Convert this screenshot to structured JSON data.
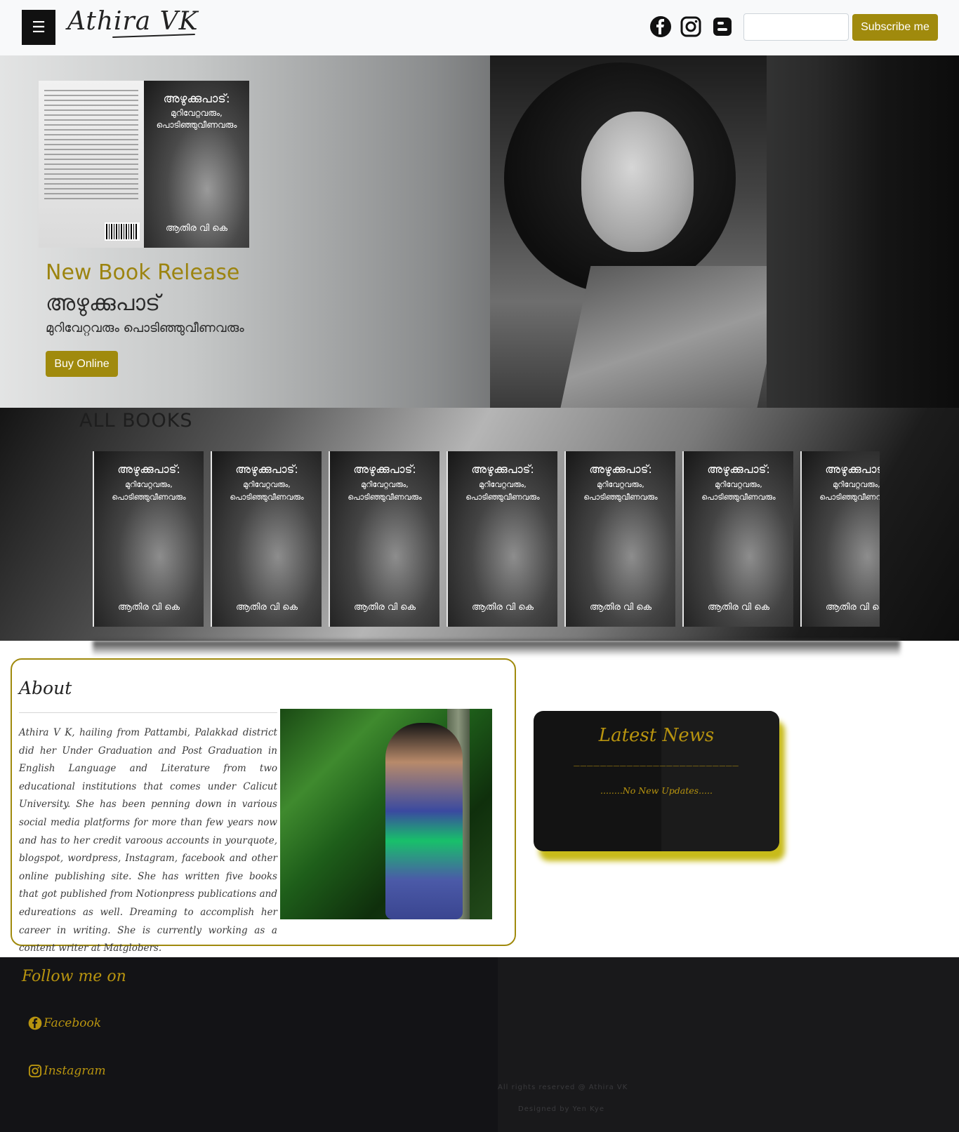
{
  "nav": {
    "menu_glyph": "☰",
    "brand": "Athira VK",
    "social_icons": [
      "facebook-icon",
      "instagram-icon",
      "blogger-icon"
    ],
    "subscribe_placeholder": "",
    "subscribe_label": "Subscribe me"
  },
  "hero": {
    "title": "New Book Release",
    "subtitle_line1": "അഴുക്കുപാട്",
    "subtitle_line2": "മുറിവേറ്റവരും പൊടിഞ്ഞുവീണവരും",
    "buy_label": "Buy Online",
    "book_cover": {
      "title": "അഴുക്കുപാട്:",
      "subtitle_1": "മുറിവേറ്റവരും,",
      "subtitle_2": "പൊടിഞ്ഞുവീണവരും",
      "author": "ആതിര വി കെ"
    }
  },
  "books": {
    "heading": "ALL BOOKS",
    "items": [
      {
        "title": "അഴുക്കുപാട്:",
        "subtitle_1": "മുറിവേറ്റവരും,",
        "subtitle_2": "പൊടിഞ്ഞുവീണവരും",
        "author": "ആതിര വി കെ"
      },
      {
        "title": "അഴുക്കുപാട്:",
        "subtitle_1": "മുറിവേറ്റവരും,",
        "subtitle_2": "പൊടിഞ്ഞുവീണവരും",
        "author": "ആതിര വി കെ"
      },
      {
        "title": "അഴുക്കുപാട്:",
        "subtitle_1": "മുറിവേറ്റവരും,",
        "subtitle_2": "പൊടിഞ്ഞുവീണവരും",
        "author": "ആതിര വി കെ"
      },
      {
        "title": "അഴുക്കുപാട്:",
        "subtitle_1": "മുറിവേറ്റവരും,",
        "subtitle_2": "പൊടിഞ്ഞുവീണവരും",
        "author": "ആതിര വി കെ"
      },
      {
        "title": "അഴുക്കുപാട്:",
        "subtitle_1": "മുറിവേറ്റവരും,",
        "subtitle_2": "പൊടിഞ്ഞുവീണവരും",
        "author": "ആതിര വി കെ"
      },
      {
        "title": "അഴുക്കുപാട്:",
        "subtitle_1": "മുറിവേറ്റവരും,",
        "subtitle_2": "പൊടിഞ്ഞുവീണവരും",
        "author": "ആതിര വി കെ"
      },
      {
        "title": "അഴുക്കുപാട്:",
        "subtitle_1": "മുറിവേറ്റവരും,",
        "subtitle_2": "പൊടിഞ്ഞുവീണവരും",
        "author": "ആതിര വി കെ"
      }
    ]
  },
  "about": {
    "title": "About",
    "text": "Athira V K, hailing from Pattambi, Palakkad district did her Under Graduation and Post Graduation in English Language and Literature from two educational institutions that comes under Calicut University. She has been penning down in various social media platforms for more than few years now and has to her credit varoous accounts in yourquote, blogspot, wordpress, Instagram, facebook and other online publishing site. She has written five books that got published from Notionpress publications and edureations as well. Dreaming to accomplish her career in writing. She is currently working as a content writer at Matglobers."
  },
  "news": {
    "title": "Latest News",
    "divider": "_________________________",
    "message": "........No New Updates....."
  },
  "footer": {
    "follow_title": "Follow me on",
    "links": [
      {
        "label": "Facebook",
        "icon": "facebook-icon"
      },
      {
        "label": "Instagram",
        "icon": "instagram-icon"
      }
    ],
    "copyright": "All rights reserved @ Athira VK",
    "designed_by": "Designed by Yen Kye"
  },
  "colors": {
    "accent": "#a08a0d",
    "gold_text": "#b8940f",
    "dark": "#131313"
  }
}
